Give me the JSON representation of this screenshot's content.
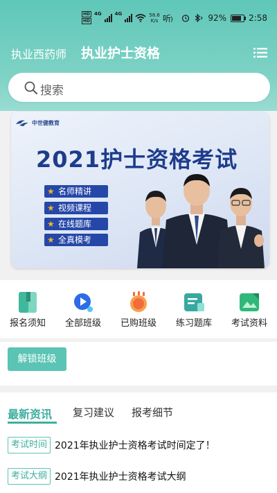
{
  "status_bar": {
    "hd1": "HD",
    "hd2": "HD",
    "net1": "4G",
    "net2": "4G",
    "speed_value": "58.6",
    "speed_unit": "K/s",
    "battery": "92%",
    "battery_level": 0.92,
    "time": "2:58"
  },
  "nav": {
    "left_link": "执业西药师",
    "title": "执业护士资格"
  },
  "search": {
    "placeholder": "搜索"
  },
  "banner": {
    "brand": "中世健教育",
    "title": "2021护士资格考试",
    "features": [
      "名师精讲",
      "视频课程",
      "在线题库",
      "全真模考"
    ]
  },
  "quick_menu": {
    "items": [
      {
        "label": "报名须知",
        "icon": "book-icon",
        "color": "#3fb89b"
      },
      {
        "label": "全部班级",
        "icon": "play-search-icon",
        "color": "#2e6be6"
      },
      {
        "label": "已购班级",
        "icon": "purchased-icon",
        "color": "#f26b3a"
      },
      {
        "label": "练习题库",
        "icon": "practice-card-icon",
        "color": "#39a8a0"
      },
      {
        "label": "考试资料",
        "icon": "image-doc-icon",
        "color": "#2fb87a"
      }
    ]
  },
  "unlock_button": "解锁班级",
  "news": {
    "tabs": [
      "最新资讯",
      "复习建议",
      "报考细节"
    ],
    "active_tab": 0,
    "items": [
      {
        "tag": "考试时间",
        "title": "2021年执业护士资格考试时间定了！"
      },
      {
        "tag": "考试大纲",
        "title": "2021年执业护士资格考试大纲"
      }
    ]
  },
  "colors": {
    "accent": "#5bc4b4",
    "accent_dark": "#3fae9f",
    "banner_title": "#1e3c8c",
    "feature_bg": "#2547a8"
  }
}
